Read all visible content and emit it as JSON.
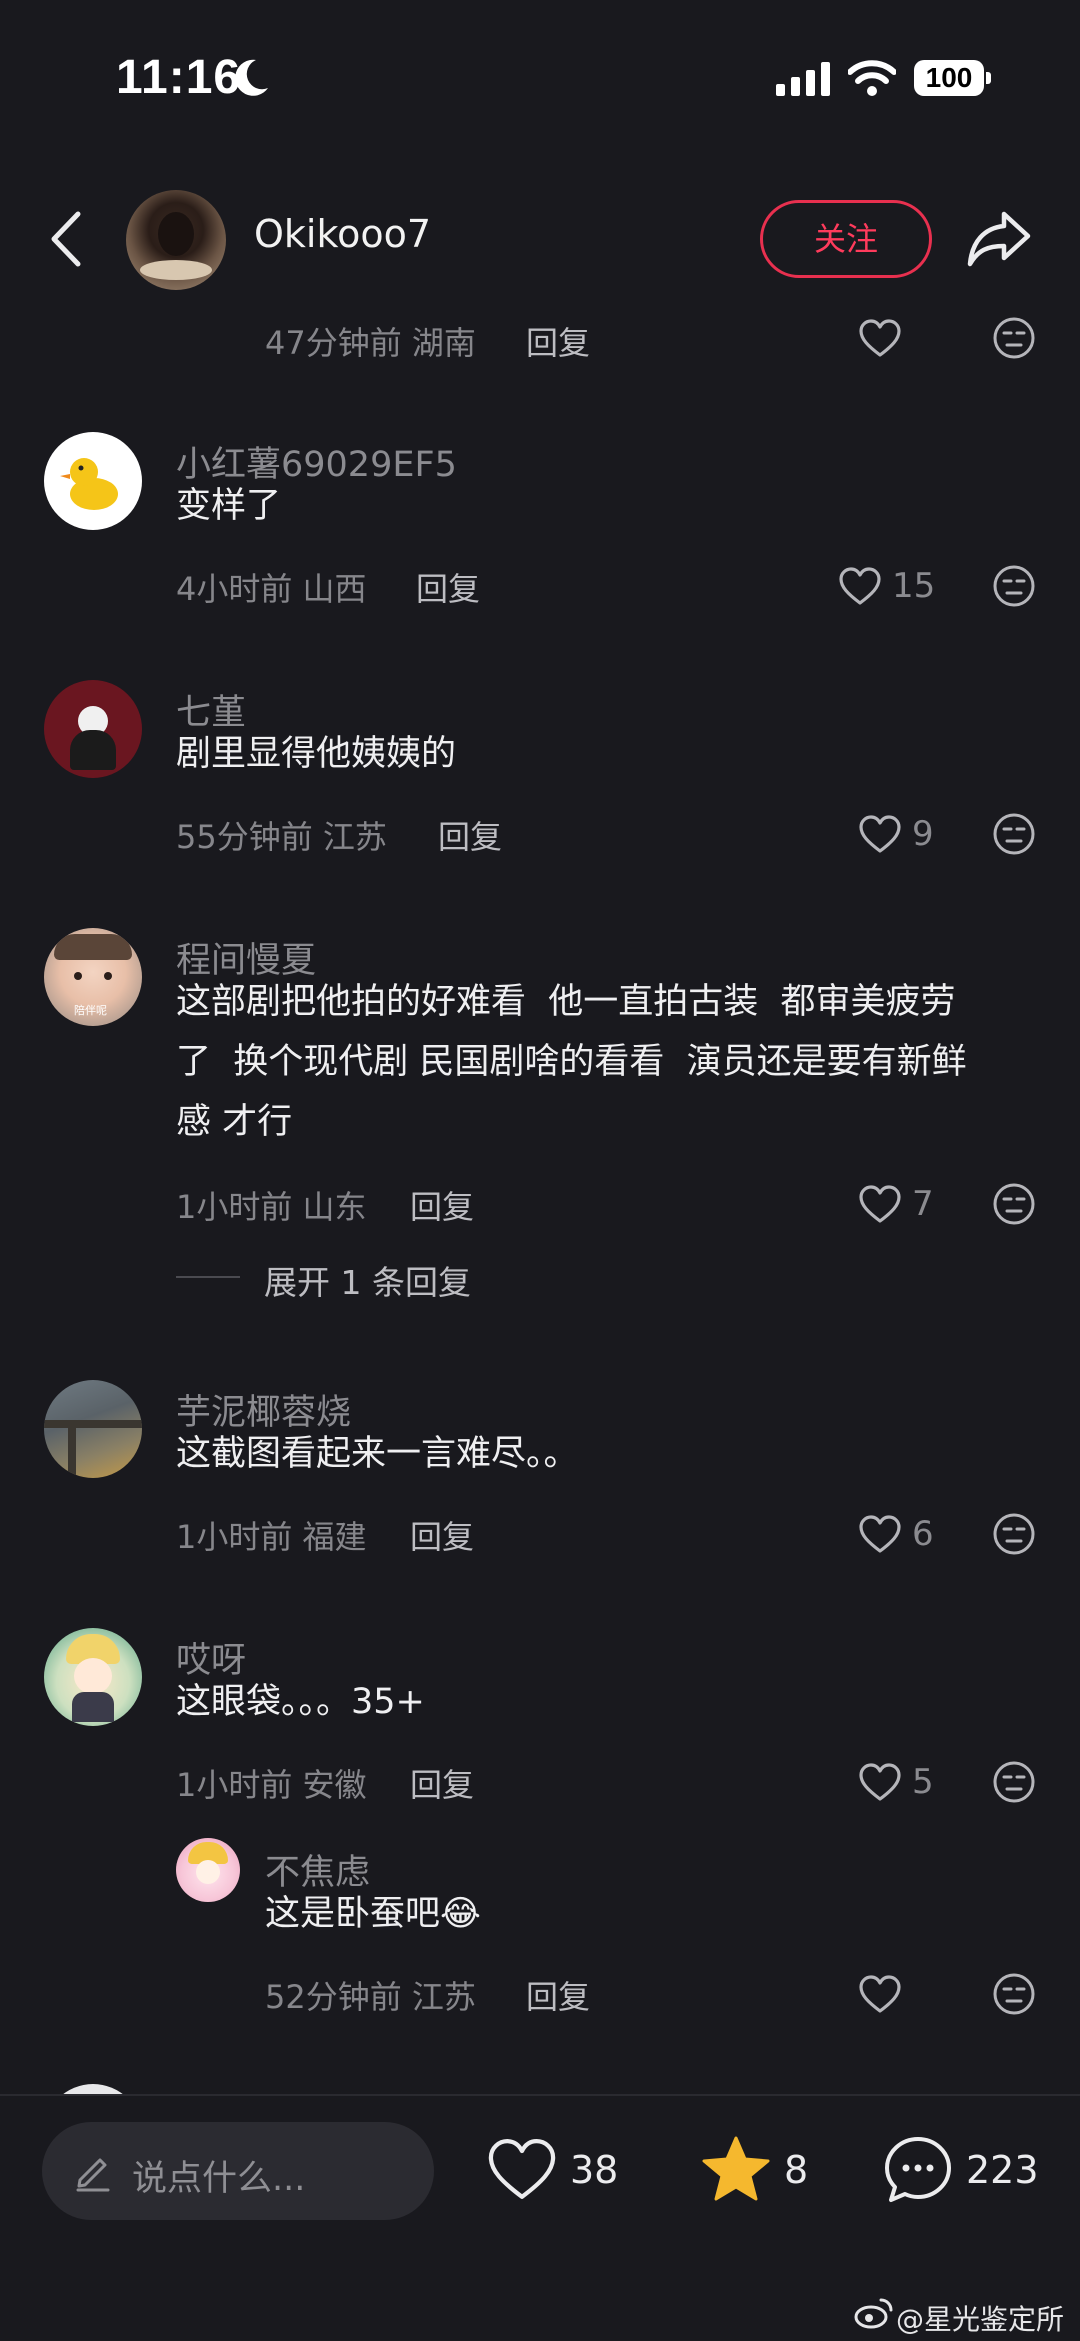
{
  "status_bar": {
    "time": "11:16",
    "battery": "100"
  },
  "header": {
    "username": "Okikooo7",
    "follow_label": "关注"
  },
  "top_partial": {
    "meta": "47分钟前 湖南",
    "reply_label": "回复"
  },
  "comments": [
    {
      "name": "小红薯69029EF5",
      "text": "变样了",
      "meta": "4小时前 山西",
      "reply_label": "回复",
      "likes": "15"
    },
    {
      "name": "七堇",
      "text": "剧里显得他姨姨的",
      "meta": "55分钟前 江苏",
      "reply_label": "回复",
      "likes": "9"
    },
    {
      "name": "程间慢夏",
      "text_lines": [
        "这部剧把他拍的好难看  他一直拍古装  都审美疲劳",
        "了  换个现代剧 民国剧啥的看看  演员还是要有新鲜",
        "感 才行"
      ],
      "meta": "1小时前 山东",
      "reply_label": "回复",
      "likes": "7",
      "expand_label": "展开 1 条回复",
      "avatar_caption": "陪伴呢"
    },
    {
      "name": "芋泥椰蓉烧",
      "text": "这截图看起来一言难尽。。",
      "meta": "1小时前 福建",
      "reply_label": "回复",
      "likes": "6"
    },
    {
      "name": "哎呀",
      "text": "这眼袋。。。35+",
      "meta": "1小时前 安徽",
      "reply_label": "回复",
      "likes": "5"
    }
  ],
  "sub_reply": {
    "name": "不焦虑",
    "text": "这是卧蚕吧",
    "emoji": "😂",
    "meta": "52分钟前 江苏",
    "reply_label": "回复"
  },
  "bottom_bar": {
    "input_placeholder": "说点什么...",
    "likes": "38",
    "stars": "8",
    "comments": "223"
  },
  "watermark": "@星光鉴定所",
  "colors": {
    "background": "#19191e",
    "accent": "#ff3b5c",
    "star": "#f5b82e"
  },
  "icons": [
    "back-arrow-icon",
    "share-icon",
    "heart-icon",
    "meh-face-icon",
    "pencil-icon",
    "star-icon",
    "chat-bubble-icon",
    "weibo-icon",
    "moon-icon",
    "signal-icon",
    "wifi-icon"
  ]
}
